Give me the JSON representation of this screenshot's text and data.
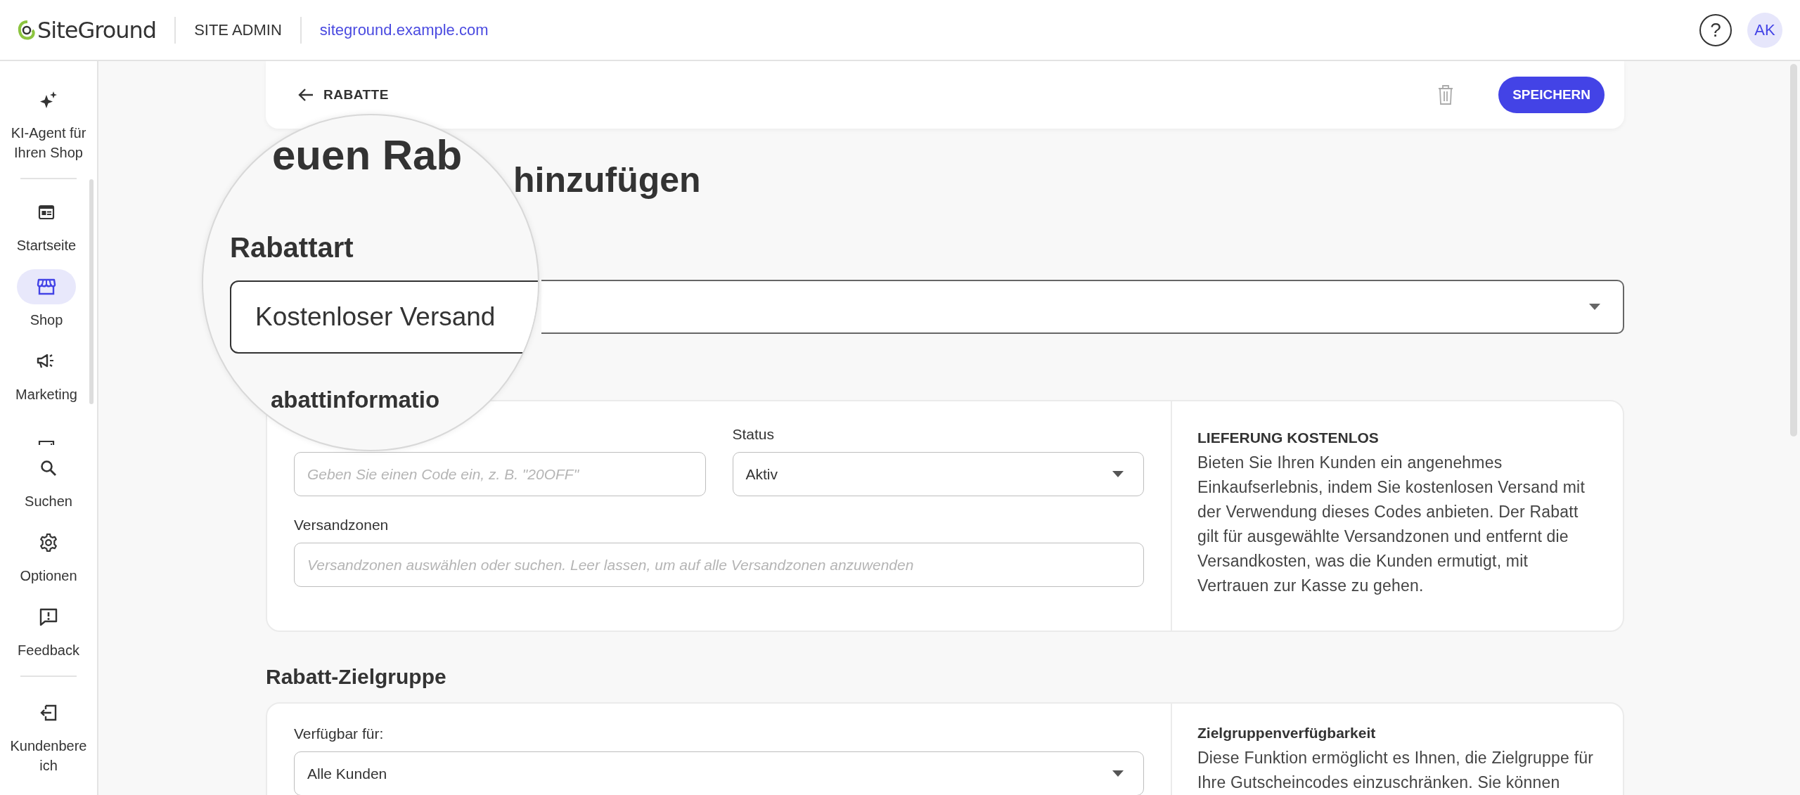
{
  "topbar": {
    "logo": "SiteGround",
    "section": "SITE ADMIN",
    "site_link": "siteground.example.com",
    "help_icon": "?",
    "avatar": "AK"
  },
  "sidebar": {
    "top": [
      {
        "kind": "sparkle",
        "label": "KI-Agent für Ihren Shop",
        "selected": false
      }
    ],
    "scroll_items": [
      {
        "kind": "home",
        "label": "Startseite",
        "selected": false
      },
      {
        "kind": "shop",
        "label": "Shop",
        "selected": true
      },
      {
        "kind": "megaphone",
        "label": "Marketing",
        "selected": false
      },
      {
        "kind": "chart",
        "selected": false
      }
    ],
    "items": [
      {
        "kind": "search",
        "label": "Suchen",
        "selected": false
      },
      {
        "kind": "gear",
        "label": "Optionen",
        "selected": false
      },
      {
        "kind": "feedback",
        "label": "Feedback",
        "selected": false
      }
    ],
    "bottom": [
      {
        "kind": "exit",
        "label": "Kundenbereich",
        "selected": false
      }
    ]
  },
  "header": {
    "back_label": "RABATTE",
    "save_button": "SPEICHERN"
  },
  "title_visible": "hinzufügen",
  "magnifier": {
    "title_fragment": "euen Rab",
    "label": "Rabattart",
    "select_value": "Kostenloser Versand",
    "section_fragment": "abattinformatio"
  },
  "discount_info": {
    "code_placeholder": "Geben Sie einen Code ein, z. B. \"20OFF\"",
    "status_label": "Status",
    "status_value": "Aktiv",
    "zones_label": "Versandzonen",
    "zones_placeholder": "Versandzonen auswählen oder suchen. Leer lassen, um auf alle Versandzonen anzuwenden",
    "info_title": "LIEFERUNG KOSTENLOS",
    "info_text": "Bieten Sie Ihren Kunden ein angenehmes Einkaufserlebnis, indem Sie kostenlosen Versand mit der Verwendung dieses Codes anbieten. Der Rabatt gilt für ausgewählte Versandzonen und entfernt die Versandkosten, was die Kunden ermutigt, mit Vertrauen zur Kasse zu gehen."
  },
  "audience": {
    "heading": "Rabatt-Zielgruppe",
    "available_label": "Verfügbar für:",
    "available_value": "Alle Kunden",
    "info_title": "Zielgruppenverfügbarkeit",
    "info_text": "Diese Funktion ermöglicht es Ihnen, die Zielgruppe für Ihre Gutscheincodes einzuschränken. Sie können"
  }
}
